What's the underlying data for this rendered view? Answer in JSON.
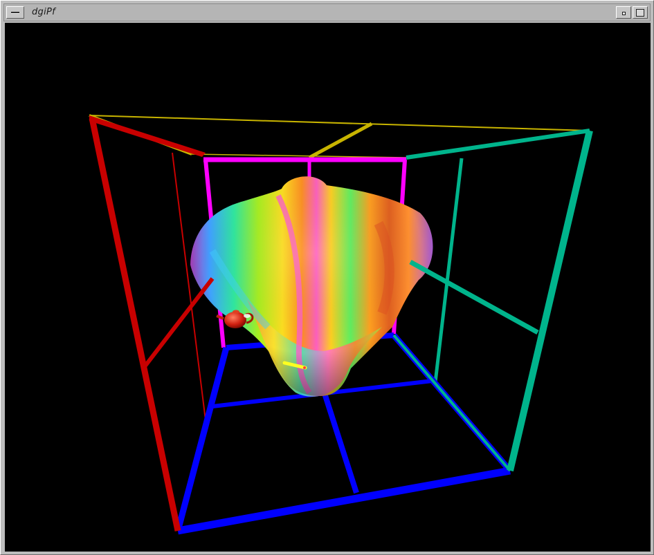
{
  "window": {
    "title": "dgiPf",
    "menu_icon": "window-menu-icon",
    "minimize_icon": "minimize-icon",
    "maximize_icon": "maximize-icon"
  },
  "scene": {
    "background": "#000000",
    "cube_edge_colors": {
      "top": "#c8b400",
      "left": "#c80000",
      "right": "#00b48c",
      "back": "#ff00ff",
      "bottom": "#0000ff"
    },
    "objects": [
      "rainbow-spherical-harmonic-surface",
      "red-teapot",
      "yellow-marker"
    ]
  }
}
